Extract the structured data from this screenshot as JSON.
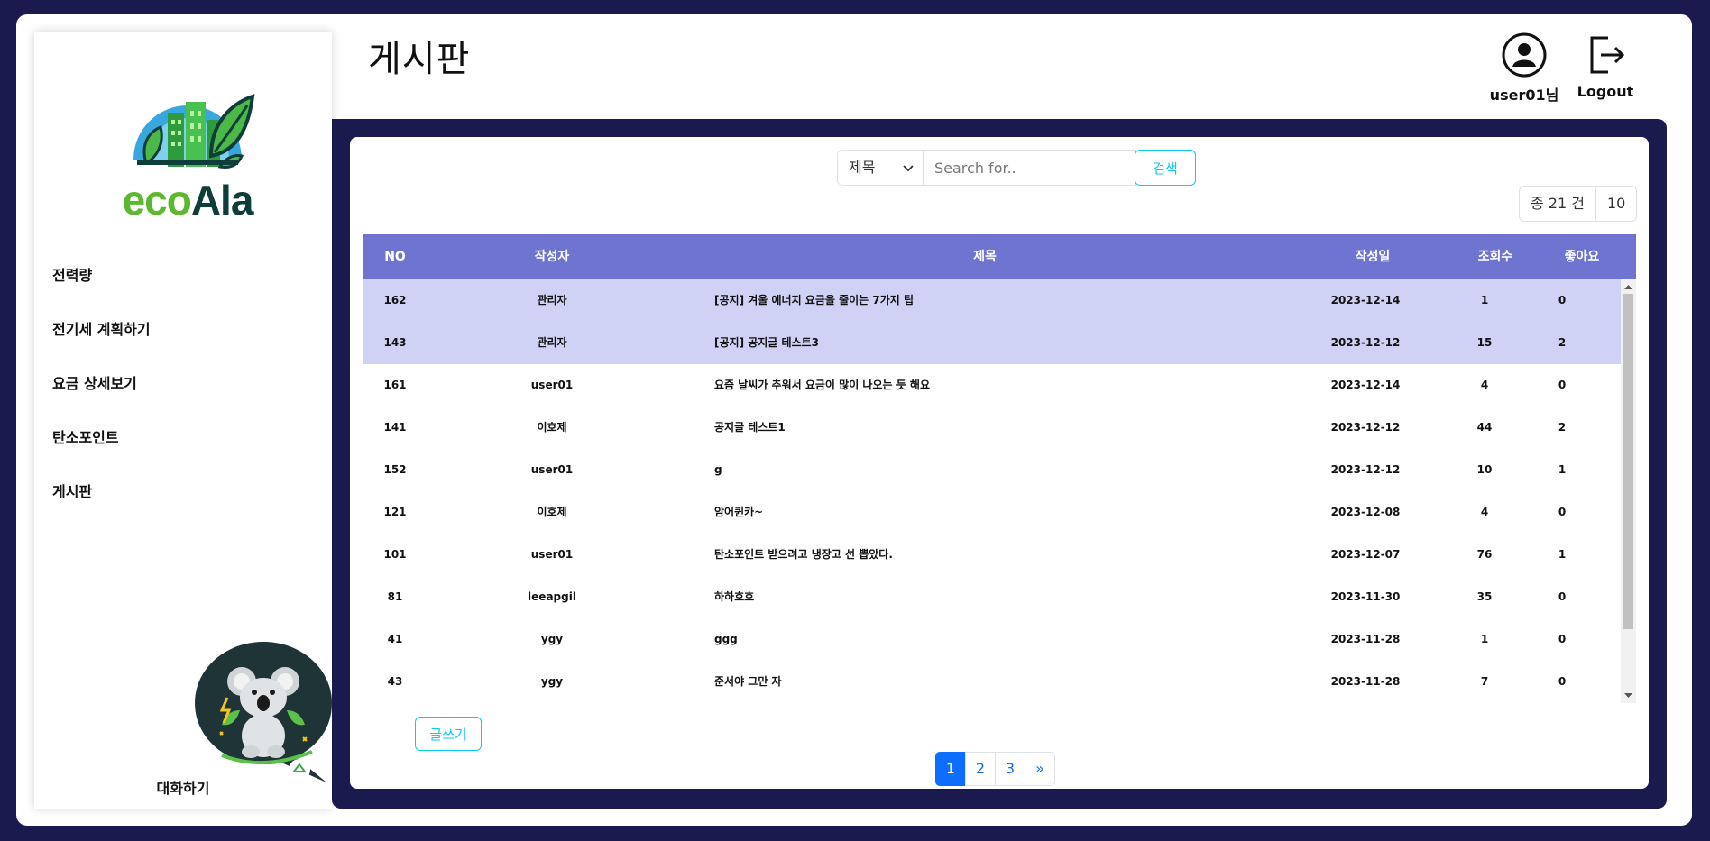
{
  "brand": {
    "logo_part1": "eco",
    "logo_part2": "Ala"
  },
  "sidebar": {
    "items": [
      {
        "label": "전력량"
      },
      {
        "label": "전기세 계획하기"
      },
      {
        "label": "요금 상세보기"
      },
      {
        "label": "탄소포인트"
      },
      {
        "label": "게시판"
      }
    ],
    "chat_label": "대화하기"
  },
  "header": {
    "title": "게시판",
    "user_label": "user01님",
    "logout_label": "Logout"
  },
  "search": {
    "field_selected": "제목",
    "placeholder": "Search for..",
    "button_label": "검색"
  },
  "summary": {
    "count_text": "종 21 건",
    "page_size": "10"
  },
  "table": {
    "headers": {
      "no": "NO",
      "author": "작성자",
      "title": "제목",
      "date": "작성일",
      "views": "조회수",
      "likes": "좋아요"
    },
    "rows": [
      {
        "no": "162",
        "author": "관리자",
        "title": "[공지] 겨울 에너지 요금을 줄이는 7가지 팁",
        "date": "2023-12-14",
        "views": "1",
        "likes": "0",
        "notice": true
      },
      {
        "no": "143",
        "author": "관리자",
        "title": "[공지] 공지글 테스트3",
        "date": "2023-12-12",
        "views": "15",
        "likes": "2",
        "notice": true
      },
      {
        "no": "161",
        "author": "user01",
        "title": "요즘 날씨가 추워서 요금이 많이 나오는 듯 해요",
        "date": "2023-12-14",
        "views": "4",
        "likes": "0",
        "notice": false
      },
      {
        "no": "141",
        "author": "이호제",
        "title": "공지글 테스트1",
        "date": "2023-12-12",
        "views": "44",
        "likes": "2",
        "notice": false
      },
      {
        "no": "152",
        "author": "user01",
        "title": "g",
        "date": "2023-12-12",
        "views": "10",
        "likes": "1",
        "notice": false
      },
      {
        "no": "121",
        "author": "이호제",
        "title": "암어퀸카~",
        "date": "2023-12-08",
        "views": "4",
        "likes": "0",
        "notice": false
      },
      {
        "no": "101",
        "author": "user01",
        "title": "탄소포인트 받으려고 냉장고 선 뽑았다.",
        "date": "2023-12-07",
        "views": "76",
        "likes": "1",
        "notice": false
      },
      {
        "no": "81",
        "author": "leeapgil",
        "title": "하하호호",
        "date": "2023-11-30",
        "views": "35",
        "likes": "0",
        "notice": false
      },
      {
        "no": "41",
        "author": "ygy",
        "title": "ggg",
        "date": "2023-11-28",
        "views": "1",
        "likes": "0",
        "notice": false
      },
      {
        "no": "43",
        "author": "ygy",
        "title": "준서야 그만 자",
        "date": "2023-11-28",
        "views": "7",
        "likes": "0",
        "notice": false
      }
    ]
  },
  "actions": {
    "write_label": "글쓰기"
  },
  "pagination": {
    "pages": [
      "1",
      "2",
      "3"
    ],
    "next": "»",
    "current": "1"
  },
  "colors": {
    "frame_bg": "#1a1a4e",
    "table_header": "#6f74d0",
    "notice_row": "#cfd2f5",
    "accent_info": "#0dcaf0",
    "accent_primary": "#0d6efd"
  }
}
